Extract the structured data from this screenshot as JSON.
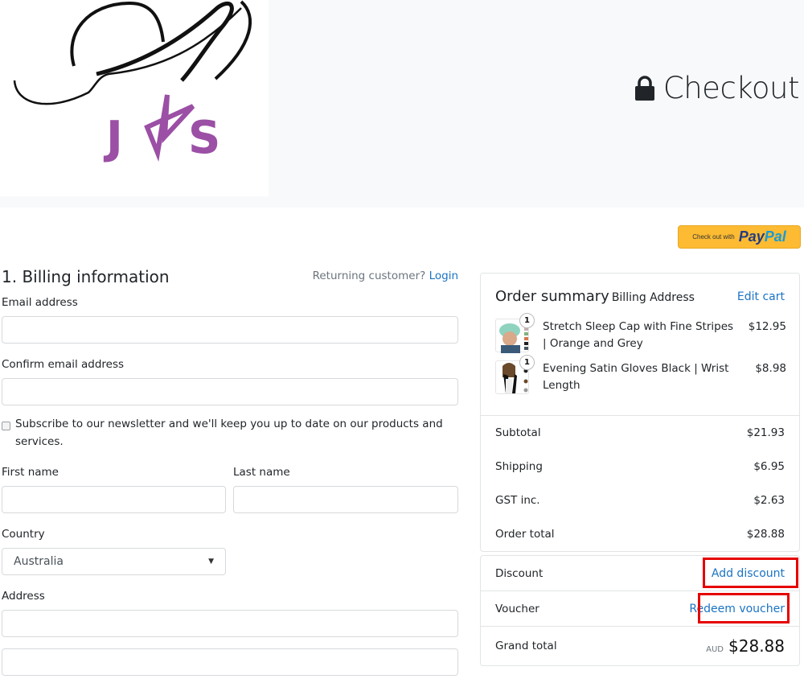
{
  "header": {
    "logo_text": "JAS",
    "title": "Checkout",
    "lock_icon": "lock-icon"
  },
  "paypal": {
    "prefix": "Check out with",
    "brand_pay": "Pay",
    "brand_pal": "Pal"
  },
  "billing": {
    "heading": "1. Billing information",
    "returning_text": "Returning customer?",
    "login_link": "Login",
    "email_label": "Email address",
    "email_value": "",
    "confirm_email_label": "Confirm email address",
    "confirm_email_value": "",
    "newsletter_label": "Subscribe to our newsletter and we'll keep you up to date on our products and services.",
    "newsletter_checked": false,
    "first_name_label": "First name",
    "first_name_value": "",
    "last_name_label": "Last name",
    "last_name_value": "",
    "country_label": "Country",
    "country_value": "Australia",
    "address_label": "Address",
    "address_line1_value": "",
    "address_line2_value": ""
  },
  "summary": {
    "title": "Order summary",
    "subtitle": "Billing Address",
    "edit_cart": "Edit cart",
    "items": [
      {
        "name": "Stretch Sleep Cap with Fine Stripes | Orange and Grey",
        "price": "$12.95",
        "qty": "1"
      },
      {
        "name": "Evening Satin Gloves Black | Wrist Length",
        "price": "$8.98",
        "qty": "1"
      }
    ],
    "totals": [
      {
        "label": "Subtotal",
        "value": "$21.93"
      },
      {
        "label": "Shipping",
        "value": "$6.95"
      },
      {
        "label": "GST inc.",
        "value": "$2.63"
      },
      {
        "label": "Order total",
        "value": "$28.88"
      }
    ],
    "discount_label": "Discount",
    "discount_link": "Add discount",
    "voucher_label": "Voucher",
    "voucher_link": "Redeem voucher",
    "grand_total_label": "Grand total",
    "grand_total_currency": "AUD",
    "grand_total_value": "$28.88",
    "highlight_color": "#e60000",
    "link_color": "#1a73c5"
  }
}
